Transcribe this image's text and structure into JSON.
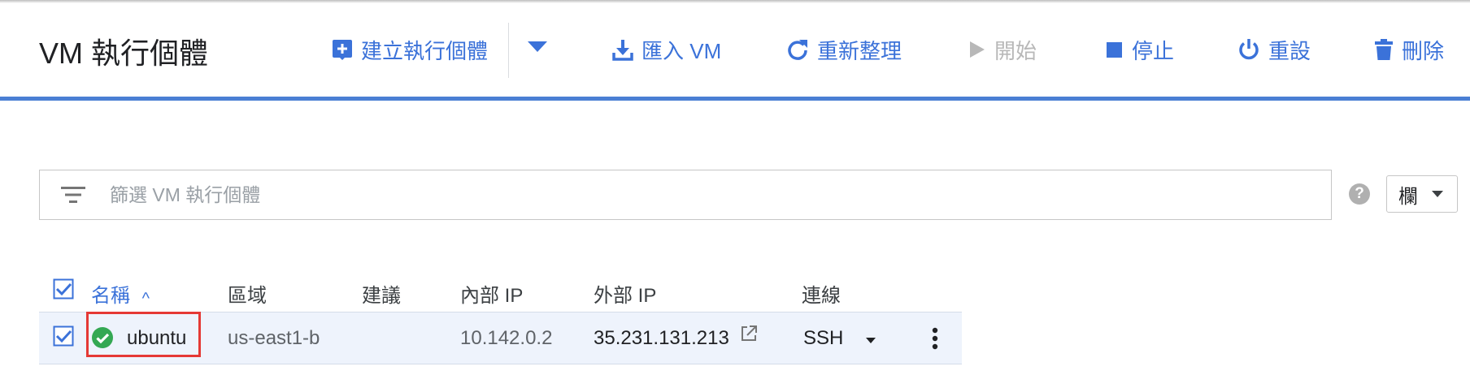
{
  "header": {
    "title": "VM 執行個體",
    "toolbar": {
      "create_label": "建立執行個體",
      "import_label": "匯入 VM",
      "refresh_label": "重新整理",
      "start_label": "開始",
      "stop_label": "停止",
      "reset_label": "重設",
      "delete_label": "刪除"
    }
  },
  "filter": {
    "placeholder": "篩選 VM 執行個體"
  },
  "columns_button": {
    "label": "欄"
  },
  "help": {
    "glyph": "?"
  },
  "table": {
    "columns": [
      "名稱",
      "區域",
      "建議",
      "內部 IP",
      "外部 IP",
      "連線"
    ],
    "sort_indicator": "^",
    "rows": [
      {
        "checked": true,
        "status": "running",
        "name": "ubuntu",
        "zone": "us-east1-b",
        "recommendation": "",
        "internal_ip": "10.142.0.2",
        "external_ip": "35.231.131.213",
        "connect": "SSH"
      }
    ]
  },
  "colors": {
    "accent": "#3b72d9",
    "header_bar": "#4a7fd4",
    "status_ok": "#34a853",
    "highlight": "#e53935",
    "disabled": "#b8b8b8"
  },
  "icons": {
    "create": "add-box-icon",
    "dropdown": "caret-down-icon",
    "import": "download-icon",
    "refresh": "refresh-icon",
    "start": "play-icon",
    "stop": "stop-square-icon",
    "reset": "power-icon",
    "delete": "trash-icon",
    "filter": "filter-lines-icon",
    "help": "help-circle-icon",
    "status": "check-circle-icon",
    "external_link": "open-in-new-icon",
    "more": "more-vert-icon"
  }
}
